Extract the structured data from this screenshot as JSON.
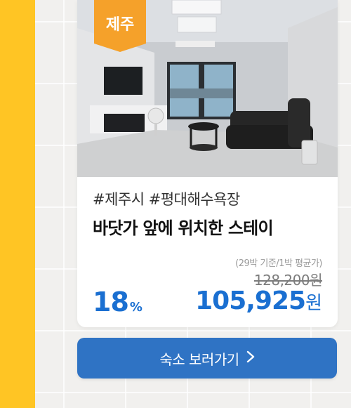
{
  "colors": {
    "accent_yellow": "#ffc524",
    "region_tag_orange": "#f5a12a",
    "primary_blue": "#1a6fd1",
    "button_blue": "#2f73c4"
  },
  "listing": {
    "region_tag": "제주",
    "hashtags": "#제주시 #평대해수욕장",
    "title": "바닷가 앞에 위치한 스테이",
    "price_note": "(29박 기준/1박 평균가)",
    "original_price": "128,200원",
    "discount_value": "18",
    "discount_unit": "%",
    "sale_price": "105,925",
    "sale_price_unit": "원"
  },
  "cta": {
    "label": "숙소 보러가기",
    "icon": "chevron-right-icon"
  }
}
